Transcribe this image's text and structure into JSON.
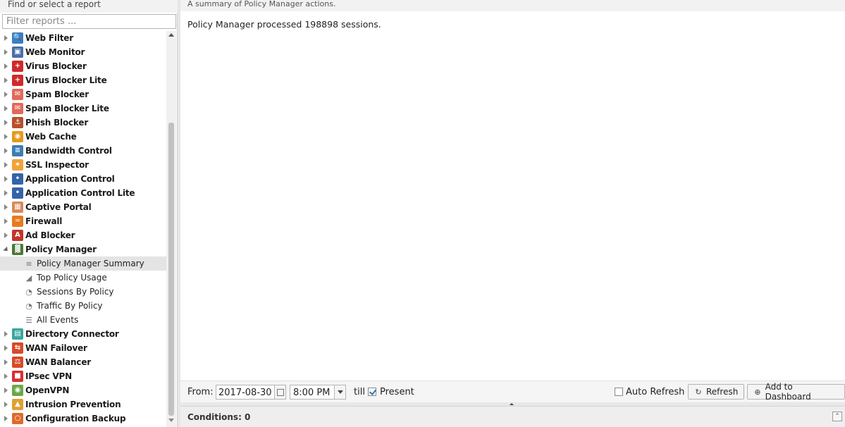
{
  "sidebar": {
    "header": "Find or select a report",
    "filter_placeholder": "Filter reports ...",
    "apps": [
      {
        "label": "Web Filter",
        "icon": "web-filter-icon",
        "color": "#3b7fc4",
        "glyph": "🔍"
      },
      {
        "label": "Web Monitor",
        "icon": "web-monitor-icon",
        "color": "#4a6ea9",
        "glyph": "▣"
      },
      {
        "label": "Virus Blocker",
        "icon": "virus-blocker-icon",
        "color": "#d02a2a",
        "glyph": "+"
      },
      {
        "label": "Virus Blocker Lite",
        "icon": "virus-blocker-lite-icon",
        "color": "#d02a2a",
        "glyph": "+"
      },
      {
        "label": "Spam Blocker",
        "icon": "spam-blocker-icon",
        "color": "#e06a5a",
        "glyph": "✉"
      },
      {
        "label": "Spam Blocker Lite",
        "icon": "spam-blocker-lite-icon",
        "color": "#e06a5a",
        "glyph": "✉"
      },
      {
        "label": "Phish Blocker",
        "icon": "phish-blocker-icon",
        "color": "#b8502a",
        "glyph": "⚓"
      },
      {
        "label": "Web Cache",
        "icon": "web-cache-icon",
        "color": "#e39b1c",
        "glyph": "◉"
      },
      {
        "label": "Bandwidth Control",
        "icon": "bandwidth-control-icon",
        "color": "#3a7fb4",
        "glyph": "≡"
      },
      {
        "label": "SSL Inspector",
        "icon": "ssl-inspector-icon",
        "color": "#f2a33a",
        "glyph": "⌖"
      },
      {
        "label": "Application Control",
        "icon": "application-control-icon",
        "color": "#3464a8",
        "glyph": "•"
      },
      {
        "label": "Application Control Lite",
        "icon": "application-control-lite-icon",
        "color": "#3464a8",
        "glyph": "•"
      },
      {
        "label": "Captive Portal",
        "icon": "captive-portal-icon",
        "color": "#d98a5a",
        "glyph": "▦"
      },
      {
        "label": "Firewall",
        "icon": "firewall-icon",
        "color": "#e87a20",
        "glyph": "═"
      },
      {
        "label": "Ad Blocker",
        "icon": "ad-blocker-icon",
        "color": "#c4332a",
        "glyph": "A"
      },
      {
        "label": "Policy Manager",
        "icon": "policy-manager-icon",
        "color": "#4a7a3a",
        "glyph": "▓",
        "expanded": true
      }
    ],
    "policy_manager_reports": [
      {
        "label": "Policy Manager Summary",
        "icon": "text-report-icon",
        "glyph": "≡",
        "selected": true
      },
      {
        "label": "Top Policy Usage",
        "icon": "area-chart-icon",
        "glyph": "◢"
      },
      {
        "label": "Sessions By Policy",
        "icon": "pie-chart-icon",
        "glyph": "◔"
      },
      {
        "label": "Traffic By Policy",
        "icon": "pie-chart-icon",
        "glyph": "◔"
      },
      {
        "label": "All Events",
        "icon": "list-icon",
        "glyph": "☰"
      }
    ],
    "apps_after": [
      {
        "label": "Directory Connector",
        "icon": "directory-connector-icon",
        "color": "#3aa6a0",
        "glyph": "▤"
      },
      {
        "label": "WAN Failover",
        "icon": "wan-failover-icon",
        "color": "#d64a2a",
        "glyph": "⇆"
      },
      {
        "label": "WAN Balancer",
        "icon": "wan-balancer-icon",
        "color": "#d64a2a",
        "glyph": "⚖"
      },
      {
        "label": "IPsec VPN",
        "icon": "ipsec-vpn-icon",
        "color": "#d63030",
        "glyph": "■"
      },
      {
        "label": "OpenVPN",
        "icon": "openvpn-icon",
        "color": "#6aa84a",
        "glyph": "◉"
      },
      {
        "label": "Intrusion Prevention",
        "icon": "intrusion-prevention-icon",
        "color": "#e0a030",
        "glyph": "▲"
      },
      {
        "label": "Configuration Backup",
        "icon": "configuration-backup-icon",
        "color": "#e06a2a",
        "glyph": "○"
      }
    ]
  },
  "main": {
    "description": "A summary of Policy Manager actions.",
    "summary_text": "Policy Manager processed 198898 sessions."
  },
  "toolbar": {
    "from_label": "From:",
    "date_value": "2017-08-30",
    "time_value": "8:00 PM",
    "till_label": "till",
    "present_label": "Present",
    "present_checked": true,
    "auto_refresh_label": "Auto Refresh",
    "auto_refresh_checked": false,
    "refresh_label": "Refresh",
    "add_dashboard_label": "Add to Dashboard"
  },
  "conditions": {
    "label": "Conditions: 0"
  }
}
